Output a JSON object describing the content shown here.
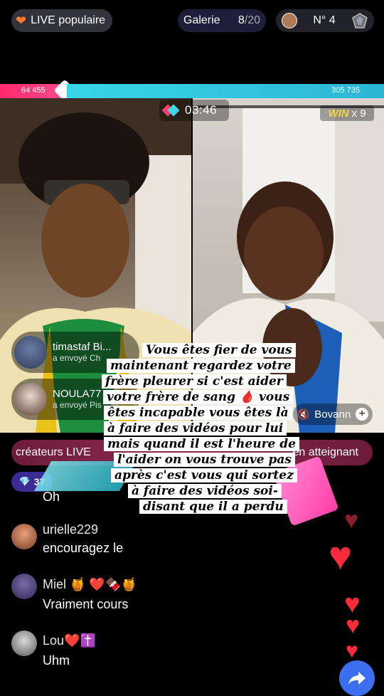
{
  "top": {
    "live_populaire": "LIVE populaire",
    "galerie_label": "Galerie",
    "galerie_count": "8",
    "galerie_total": "/20",
    "rank": "N° 4"
  },
  "battle": {
    "left_score": "64 455",
    "right_score": "305 735",
    "timer": "03:46",
    "win_label": "WIN",
    "win_count": "x 9",
    "left_share": 0.174
  },
  "gifts": [
    {
      "name": "timastaf Bi...",
      "sub": "a envoyé  Ch"
    },
    {
      "name": "NOULA77",
      "sub": "a envoyé  Pis"
    }
  ],
  "opponent": {
    "name": "Bovann"
  },
  "banner": {
    "left": "créateurs LIVE",
    "right": "en atteignant"
  },
  "gem_badge": "37",
  "caption": [
    "Vous êtes fier de vous",
    "maintenant regardez votre",
    "frère pleurer si c'est aider",
    "votre frère de sang 🩸 vous",
    "êtes incapable vous êtes là",
    "à faire des vidéos pour lui",
    "mais quand il est l'heure de",
    "l'aider on vous trouve pas",
    "après c'est vous qui sortez",
    "à faire des vidéos soi-",
    "disant que il a perdu"
  ],
  "comments": [
    {
      "name": "",
      "text": "Oh"
    },
    {
      "name": "urielle229",
      "text": "encouragez le"
    },
    {
      "name": "Miel 🍯 ❤️🍫🍯",
      "text": "Vraiment cours"
    },
    {
      "name": "Lou❤️✝️",
      "text": "Uhm"
    }
  ],
  "icons": {
    "heart": "heart-icon",
    "trophy": "trophy-icon",
    "gem": "gem-icon",
    "share": "share-icon",
    "mute": "mute-icon"
  },
  "colors": {
    "battle_left": "#ff2a6d",
    "battle_right": "#38d5e8",
    "banner": "#8a2a4d",
    "gem_badge": "#3b2b94"
  }
}
